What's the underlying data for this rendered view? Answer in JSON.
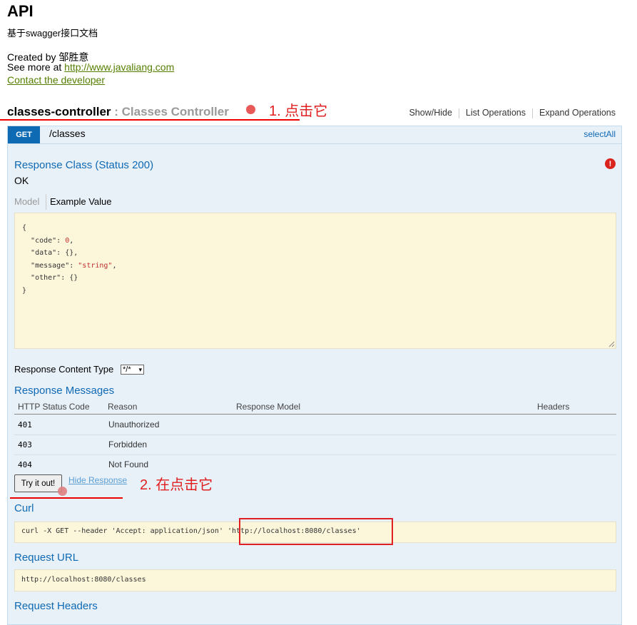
{
  "header": {
    "title": "API",
    "description": "基于swagger接口文档",
    "created_by": "Created by 邹胜意",
    "see_more_prefix": "See more at ",
    "see_more_link": "http://www.javaliang.com",
    "contact": "Contact the developer"
  },
  "controller": {
    "name": "classes-controller",
    "display": " : Classes Controller",
    "annotation": "1. 点击它",
    "links": [
      "Show/Hide",
      "List Operations",
      "Expand Operations"
    ]
  },
  "operation": {
    "method": "GET",
    "path": "/classes",
    "select_all": "selectAll",
    "response_class_title": "Response Class (Status 200)",
    "response_class_value": "OK",
    "tabs": {
      "model": "Model",
      "example": "Example Value"
    },
    "example_value": {
      "code_key": "\"code\"",
      "code_val": "0",
      "data_key": "\"data\"",
      "data_val": "{}",
      "message_key": "\"message\"",
      "message_val": "\"string\"",
      "other_key": "\"other\"",
      "other_val": "{}"
    },
    "response_content_type_label": "Response Content Type",
    "response_content_type_value": "*/*",
    "response_messages_title": "Response Messages",
    "table_headers": [
      "HTTP Status Code",
      "Reason",
      "Response Model",
      "Headers"
    ],
    "rows": [
      {
        "code": "401",
        "reason": "Unauthorized"
      },
      {
        "code": "403",
        "reason": "Forbidden"
      },
      {
        "code": "404",
        "reason": "Not Found"
      }
    ],
    "try_button": "Try it out!",
    "hide_response": "Hide Response",
    "annotation2": "2. 在点击它",
    "curl_title": "Curl",
    "curl_command": "curl -X GET --header 'Accept: application/json' 'http://localhost:8080/classes'",
    "request_url_title": "Request URL",
    "request_url": "http://localhost:8080/classes",
    "request_headers_title": "Request Headers"
  },
  "colors": {
    "accent_blue": "#0f6ab4",
    "link_green": "#547f00",
    "annotation_red": "#e02020",
    "panel_bg": "#e8f0f8",
    "code_bg": "#fcf6db"
  }
}
